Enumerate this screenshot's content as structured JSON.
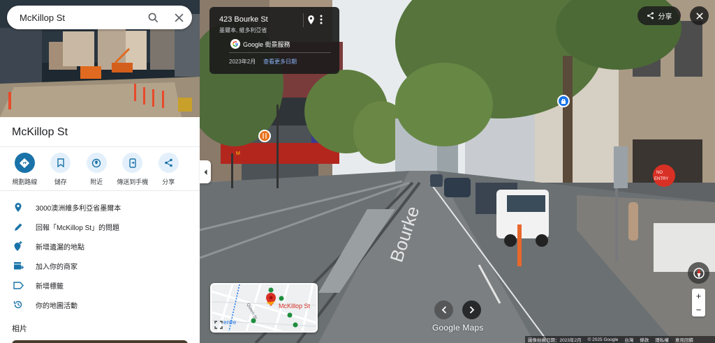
{
  "search": {
    "value": "McKillop St"
  },
  "place": {
    "title": "McKillop St"
  },
  "actions": [
    {
      "label": "規劃路線",
      "icon": "directions-icon"
    },
    {
      "label": "儲存",
      "icon": "bookmark-icon"
    },
    {
      "label": "附近",
      "icon": "nearby-icon"
    },
    {
      "label": "傳送到手機",
      "icon": "send-to-phone-icon"
    },
    {
      "label": "分享",
      "icon": "share-icon"
    }
  ],
  "info": [
    {
      "text": "3000澳洲維多利亞省墨爾本",
      "icon": "location-pin-icon"
    },
    {
      "text": "回報「McKillop St」的問題",
      "icon": "edit-pencil-icon"
    },
    {
      "text": "新增遺漏的地點",
      "icon": "add-place-icon"
    },
    {
      "text": "加入你的商家",
      "icon": "add-business-icon"
    },
    {
      "text": "新增標籤",
      "icon": "label-icon"
    },
    {
      "text": "你的地圖活動",
      "icon": "history-icon"
    }
  ],
  "photos_label": "相片",
  "address_card": {
    "line1": "423 Bourke St",
    "line2": "墨爾本, 維多利亞省",
    "source": "Google 街景服務",
    "date": "2023年2月",
    "more_dates": "查看更多日期"
  },
  "share_button": "分享",
  "minimap": {
    "street": "Queen St",
    "place": "McKillop St",
    "centre": "entre"
  },
  "logo": "Google Maps",
  "zoom": {
    "in": "+",
    "out": "−"
  },
  "footer": [
    "圖像拍攝日期：2023年2月",
    "© 2025 Google",
    "台灣",
    "條款",
    "隱私權",
    "意見回饋"
  ],
  "colors": {
    "accent": "#1a73a8",
    "light_accent": "#e3f0fb",
    "card_bg": "#1c1c1c",
    "link": "#8ab4f8",
    "pin_red": "#d93025"
  }
}
